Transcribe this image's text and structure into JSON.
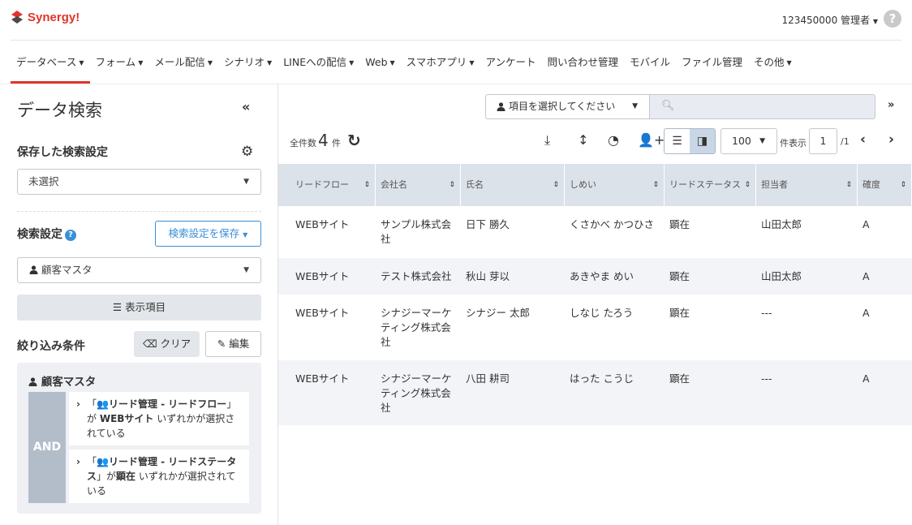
{
  "header": {
    "logo_text": "Synergy!",
    "user": "123450000 管理者",
    "help": "?"
  },
  "nav": [
    {
      "label": "データベース",
      "caret": true,
      "active": true
    },
    {
      "label": "フォーム",
      "caret": true
    },
    {
      "label": "メール配信",
      "caret": true
    },
    {
      "label": "シナリオ",
      "caret": true
    },
    {
      "label": "LINEへの配信",
      "caret": true
    },
    {
      "label": "Web",
      "caret": true
    },
    {
      "label": "スマホアプリ",
      "caret": true
    },
    {
      "label": "アンケート",
      "caret": false
    },
    {
      "label": "問い合わせ管理",
      "caret": false
    },
    {
      "label": "モバイル",
      "caret": false
    },
    {
      "label": "ファイル管理",
      "caret": false
    },
    {
      "label": "その他",
      "caret": true
    }
  ],
  "sidebar": {
    "title": "データ検索",
    "saved_label": "保存した検索設定",
    "saved_value": "未選択",
    "search_label": "検索設定",
    "save_button": "検索設定を保存",
    "master_value": "顧客マスタ",
    "display_button": "表示項目",
    "filter_label": "絞り込み条件",
    "clear_button": "クリア",
    "edit_button": "編集",
    "cond_title": "顧客マスタ",
    "and_label": "AND",
    "cond1": {
      "l1_pre": "「",
      "l1_bold": "リード管理 - リードフロー",
      "l1_post": "」",
      "l2_pre": "が ",
      "l2_bold": "WEBサイト",
      "l2_post": " いずれかが選択されている"
    },
    "cond2": {
      "l1_pre": "「",
      "l1_bold": "リード管理 - リードステータス",
      "l1_post": "」が",
      "l2_bold": "顕在",
      "l2_post": " いずれかが選択されている"
    }
  },
  "toolbar": {
    "field_select": "項目を選択してください",
    "search_placeholder": "",
    "count_label": "全件数",
    "count": "4",
    "count_unit": "件",
    "per_page": "100",
    "per_page_label": "件表示",
    "page": "1",
    "page_total": "/1"
  },
  "table": {
    "columns": [
      "リードフロー",
      "会社名",
      "氏名",
      "しめい",
      "リードステータス",
      "担当者",
      "確度"
    ],
    "rows": [
      [
        "WEBサイト",
        "サンプル株式会社",
        "日下 勝久",
        "くさかべ かつひさ",
        "顕在",
        "山田太郎",
        "A"
      ],
      [
        "WEBサイト",
        "テスト株式会社",
        "秋山 芽以",
        "あきやま めい",
        "顕在",
        "山田太郎",
        "A"
      ],
      [
        "WEBサイト",
        "シナジーマーケティング株式会社",
        "シナジー 太郎",
        "しなじ たろう",
        "顕在",
        "---",
        "A"
      ],
      [
        "WEBサイト",
        "シナジーマーケティング株式会社",
        "八田 耕司",
        "はった こうじ",
        "顕在",
        "---",
        "A"
      ]
    ]
  },
  "colors": {
    "accent": "#e0352b",
    "link": "#3a8fd8",
    "header_bg": "#dce2ea"
  }
}
